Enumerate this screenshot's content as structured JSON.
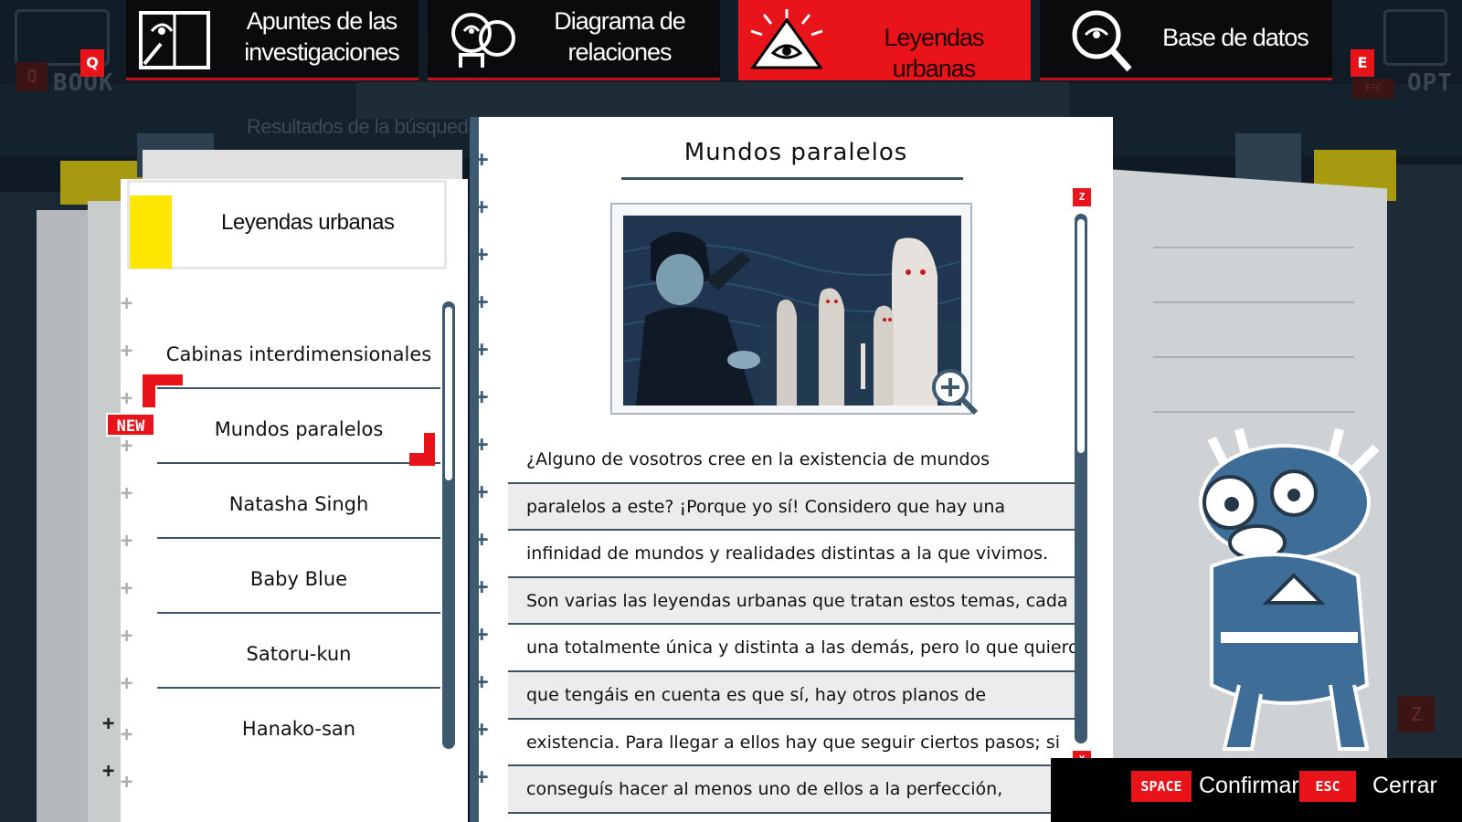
{
  "topbar": {
    "left_key": {
      "badge": "Q",
      "ghost_badge": "Q",
      "word": "BOOK"
    },
    "right_key": {
      "badge": "E",
      "ghost_badge": "ESC",
      "word": "OPT"
    },
    "tabs": [
      {
        "label_line1": "Apuntes de las",
        "label_line2": "investigaciones",
        "icon": "notebook-icon",
        "active": false
      },
      {
        "label_line1": "Diagrama de",
        "label_line2": "relaciones",
        "icon": "relations-icon",
        "active": false
      },
      {
        "label_line1": "Leyendas urbanas",
        "label_line2": "",
        "icon": "illuminati-eye-icon",
        "active": true
      },
      {
        "label_line1": "Base de datos",
        "label_line2": "",
        "icon": "database-magnifier-icon",
        "active": false
      }
    ]
  },
  "sidebar": {
    "search_results_label": "Resultados de la búsqueda",
    "category_title": "Leyendas urbanas",
    "new_badge": "NEW",
    "items": [
      {
        "label": "Cabinas interdimensionales"
      },
      {
        "label": "Mundos paralelos"
      },
      {
        "label": "Natasha Singh"
      },
      {
        "label": "Baby Blue"
      },
      {
        "label": "Satoru-kun"
      },
      {
        "label": "Hanako-san"
      }
    ],
    "selected_index": 1,
    "scroll_fraction": 0.0
  },
  "document": {
    "title": "Mundos paralelos",
    "image": "illustration-parallel-worlds",
    "zoom_icon": "zoom-in-icon",
    "scroll_up_key": "Z",
    "scroll_down_key": "X",
    "lines": [
      "¿Alguno de vosotros cree en la existencia de mundos",
      "paralelos a este? ¡Porque yo sí! Considero que hay una",
      "infinidad de mundos y realidades distintas a la que vivimos.",
      "Son varias las leyendas urbanas que tratan estos temas, cada",
      "una totalmente única y distinta a las demás, pero lo que quiero",
      "que tengáis en cuenta es que sí, hay otros planos de",
      "existencia. Para llegar a ellos hay que seguir ciertos pasos; si",
      "conseguís hacer al menos uno de ellos a la perfección,"
    ]
  },
  "decor": {
    "ghost_z": "Z"
  },
  "actions": {
    "confirm_key": "SPACE",
    "confirm_label": "Confirmar",
    "close_key": "ESC",
    "close_label": "Cerrar"
  },
  "colors": {
    "accent_red": "#e8141a",
    "highlight_yellow": "#ffe600",
    "line_blue": "#3c5466",
    "background": "#0d1822"
  }
}
